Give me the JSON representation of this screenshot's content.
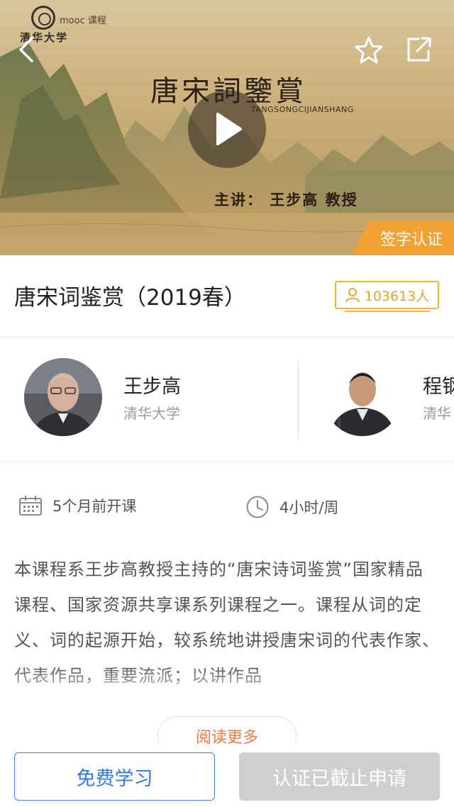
{
  "video": {
    "logo_brand": "mooc 课程",
    "logo_university": "清华大学",
    "title_calligraphy": "唐宋詞鑒賞",
    "title_pinyin": "TANGSONGCIJIANSHANG",
    "lecturer_line": "主讲：  王步高 教授",
    "cert_badge": "签字认证",
    "icons": {
      "back": "chevron-left-icon",
      "favorite": "star-icon",
      "share": "share-icon",
      "play": "play-icon"
    }
  },
  "course": {
    "title": "唐宋词鉴赏（2019春）",
    "enrolled": "103613人",
    "enrolled_icon": "person-icon"
  },
  "teachers": [
    {
      "name": "王步高",
      "org": "清华大学"
    },
    {
      "name": "程钢",
      "org": "清华"
    }
  ],
  "meta": {
    "start": "5个月前开课",
    "start_icon": "calendar-icon",
    "effort": "4小时/周",
    "effort_icon": "clock-icon"
  },
  "description": "本课程系王步高教授主持的“唐宋诗词鉴赏”国家精品课程、国家资源共享课系列课程之一。课程从词的定义、词的起源开始，较系统地讲授唐宋词的代表作家、代表作品，重要流派；以讲作品",
  "read_more": "阅读更多",
  "actions": {
    "free_learn": "免费学习",
    "cert_closed": "认证已截止申请"
  },
  "colors": {
    "accent_orange": "#f2a135",
    "enroll_yellow": "#f2b535",
    "primary_blue": "#2f7be8",
    "disabled_gray": "#cfcfcf",
    "read_more_orange": "#ee7a44"
  }
}
